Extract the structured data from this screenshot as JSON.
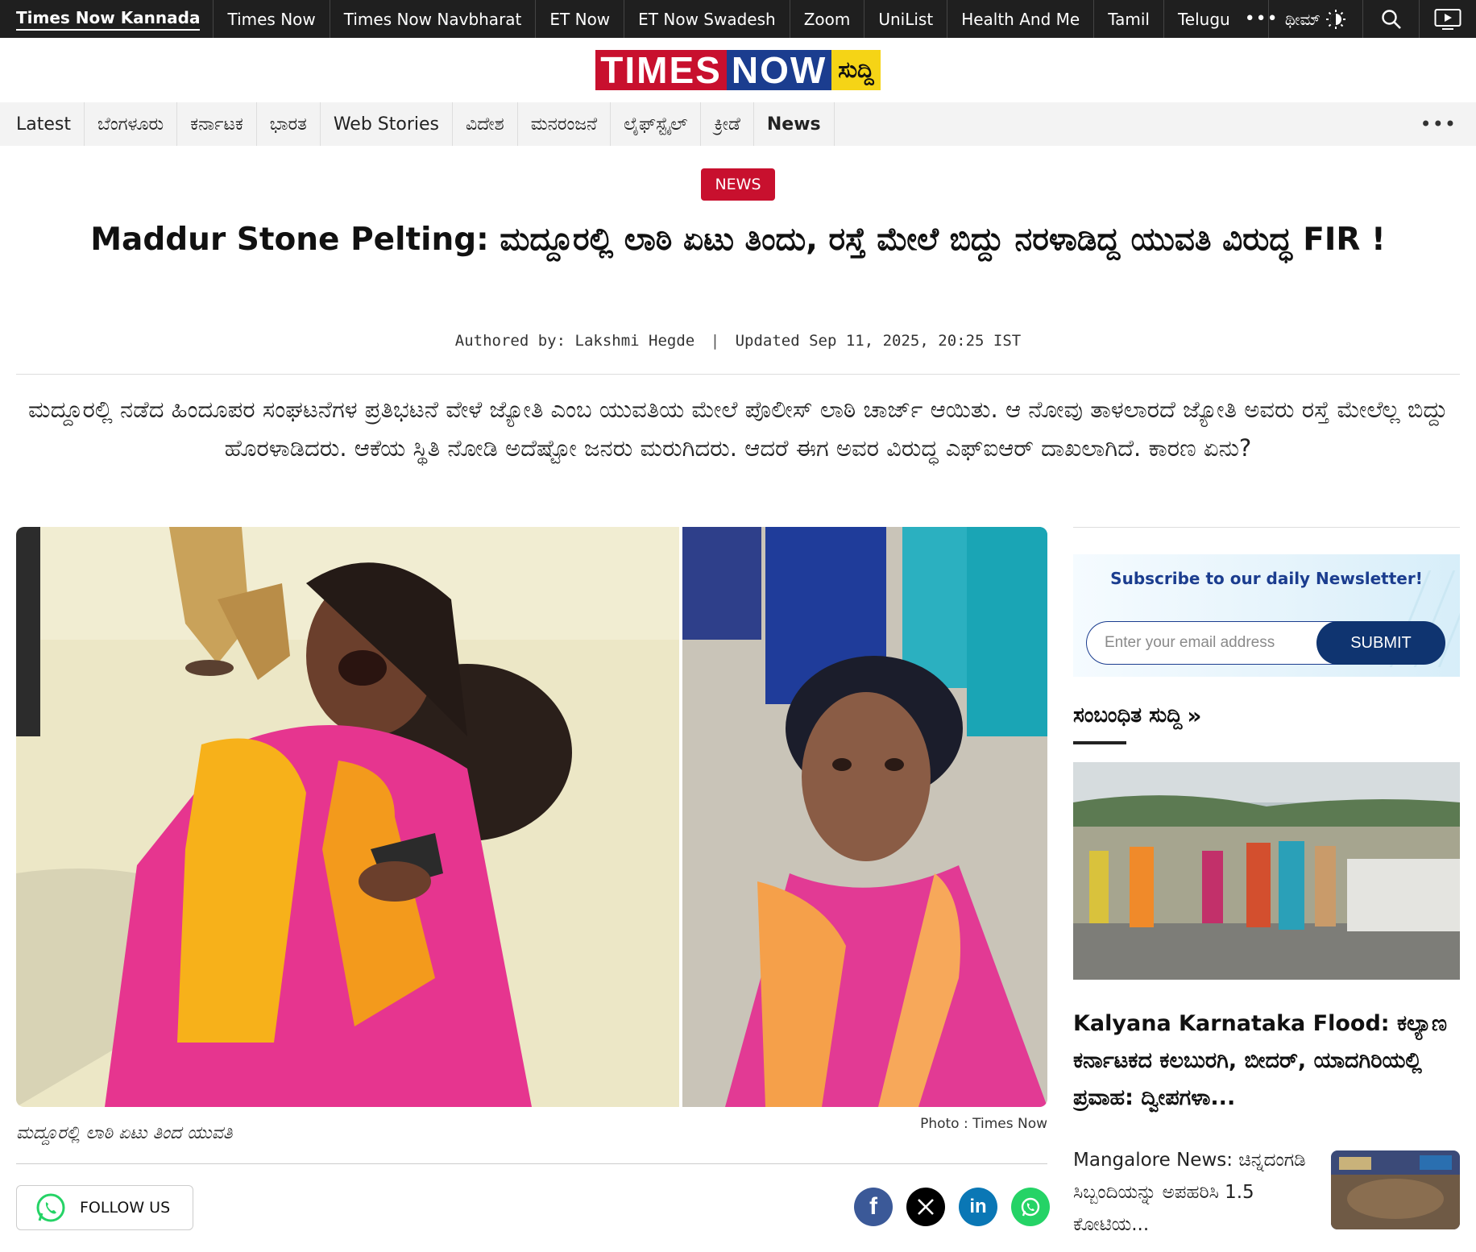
{
  "network": {
    "items": [
      "Times Now Kannada",
      "Times Now",
      "Times Now Navbharat",
      "ET Now",
      "ET Now Swadesh",
      "Zoom",
      "UniList",
      "Health And Me",
      "Tamil",
      "Telugu"
    ],
    "more": "•••",
    "theme_label": "ಥೀಮ್"
  },
  "logo": {
    "times": "TIMES",
    "now": "NOW",
    "suddi": "ಸುದ್ದಿ"
  },
  "categories": [
    "Latest",
    "ಬೆಂಗಳೂರು",
    "ಕರ್ನಾಟಕ",
    "ಭಾರತ",
    "Web Stories",
    "ವಿದೇಶ",
    "ಮನರಂಜನೆ",
    "ಲೈಫ್‌ಸ್ಟೈಲ್",
    "ಕ್ರೀಡೆ",
    "News"
  ],
  "category_more": "•••",
  "article": {
    "badge": "NEWS",
    "headline": "Maddur Stone Pelting: ಮದ್ದೂರಲ್ಲಿ ಲಾಠಿ ಏಟು ತಿಂದು, ರಸ್ತೆ ಮೇಲೆ ಬಿದ್ದು ನರಳಾಡಿದ್ದ ಯುವತಿ ವಿರುದ್ಧ FIR !",
    "authored_label": "Authored by:",
    "author": "Lakshmi Hegde",
    "updated": "Updated Sep 11, 2025, 20:25 IST",
    "summary": "ಮದ್ದೂರಲ್ಲಿ ನಡೆದ ಹಿಂದೂಪರ ಸಂಘಟನೆಗಳ ಪ್ರತಿಭಟನೆ ವೇಳೆ ಜ್ಯೋತಿ ಎಂಬ ಯುವತಿಯ ಮೇಲೆ ಪೊಲೀಸ್ ಲಾಠಿ ಚಾರ್ಜ್ ಆಯಿತು. ಆ ನೋವು ತಾಳಲಾರದೆ ಜ್ಯೋತಿ ಅವರು ರಸ್ತೆ ಮೇಲೆಲ್ಲ ಬಿದ್ದು ಹೊರಳಾಡಿದರು. ಆಕೆಯ ಸ್ಥಿತಿ ನೋಡಿ ಅದೆಷ್ಟೋ ಜನರು ಮರುಗಿದರು. ಆದರೆ ಈಗ ಅವರ ವಿರುದ್ಧ ಎಫ್‌ಐಆರ್ ದಾಖಲಾಗಿದೆ. ಕಾರಣ ಏನು?",
    "caption": "ಮದ್ದೂರಲ್ಲಿ ಲಾಠಿ ಏಟು ತಿಂದ ಯುವತಿ",
    "photo_credit": "Photo : Times Now",
    "follow_label": "FOLLOW US"
  },
  "share": [
    "facebook-icon",
    "x-icon",
    "linkedin-icon",
    "whatsapp-icon"
  ],
  "newsletter": {
    "title": "Subscribe to our daily Newsletter!",
    "placeholder": "Enter your email address",
    "submit": "SUBMIT"
  },
  "related": {
    "heading": "ಸಂಬಂಧಿತ ಸುದ್ದಿ",
    "arrow": "»",
    "items": [
      {
        "title": "Kalyana Karnataka Flood: ಕಲ್ಯಾಣ ಕರ್ನಾಟಕದ ಕಲಬುರಗಿ, ಬೀದರ್, ಯಾದಗಿರಿಯಲ್ಲಿ ಪ್ರವಾಹ: ದ್ವೀಪಗಳಾ..."
      },
      {
        "title": "Mangalore News: ಚಿನ್ನದಂಗಡಿ ಸಿಬ್ಬಂದಿಯನ್ನು ಅಪಹರಿಸಿ 1.5 ಕೋಟಿಯ..."
      }
    ]
  },
  "colors": {
    "brand_red": "#c8102e",
    "brand_blue": "#1b3d8f",
    "brand_yellow": "#f5d416",
    "topbar": "#1f1f1f"
  }
}
